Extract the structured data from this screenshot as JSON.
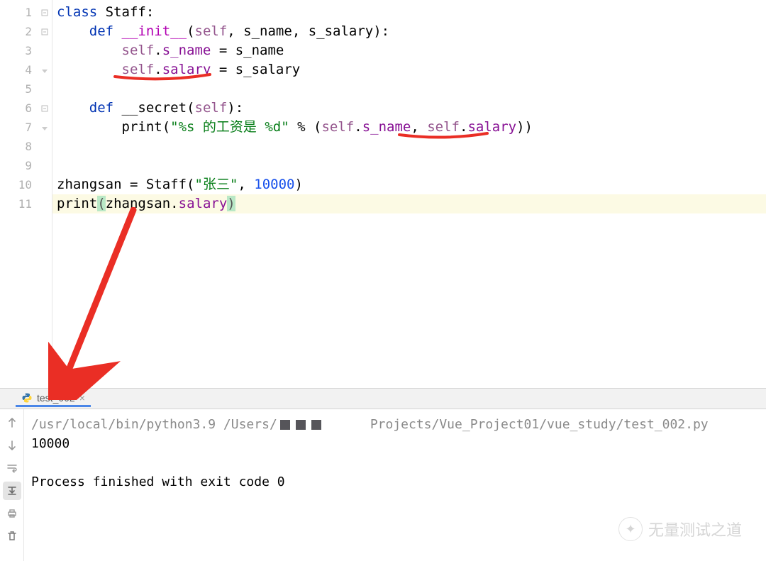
{
  "editor": {
    "line_numbers": [
      "1",
      "2",
      "3",
      "4",
      "5",
      "6",
      "7",
      "8",
      "9",
      "10",
      "11"
    ],
    "lines": {
      "l1": {
        "kw_class": "class",
        "cls": "Staff",
        "colon": ":"
      },
      "l2": {
        "kw_def": "def",
        "fn": "__init__",
        "p1": "(",
        "self": "self",
        "c1": ", ",
        "a1": "s_name",
        "c2": ", ",
        "a2": "s_salary",
        "p2": "):"
      },
      "l3": {
        "self": "self",
        "dot": ".",
        "attr": "s_name",
        "eq": " = ",
        "rhs": "s_name"
      },
      "l4": {
        "self": "self",
        "dot": ".",
        "attr": "salary",
        "eq": " = ",
        "rhs": "s_salary"
      },
      "l6": {
        "kw_def": "def",
        "fn": "__secret",
        "p1": "(",
        "self": "self",
        "p2": "):"
      },
      "l7": {
        "print": "print",
        "p1": "(",
        "str": "\"%s 的工资是 %d\"",
        "pct": " % ",
        "p2": "(",
        "self1": "self",
        "dot1": ".",
        "attr1": "s_name",
        "c": ", ",
        "self2": "self",
        "dot2": ".",
        "attr2": "salary",
        "p3": "))"
      },
      "l10": {
        "lhs": "zhangsan",
        "eq": " = ",
        "cls": "Staff",
        "p1": "(",
        "str": "\"张三\"",
        "c": ", ",
        "num": "10000",
        "p2": ")"
      },
      "l11": {
        "print": "print",
        "p1": "(",
        "obj": "zhangsan",
        "dot": ".",
        "attr": "salary",
        "p2": ")"
      }
    }
  },
  "run": {
    "tab_label": "test_002",
    "cmd_left": "/usr/local/bin/python3.9 /Users/",
    "cmd_right": "Projects/Vue_Project01/vue_study/test_002.py",
    "output_value": "10000",
    "exit_msg": "Process finished with exit code 0"
  },
  "watermark": {
    "text": "无量测试之道"
  },
  "icons": {
    "up": "arrow-up",
    "down": "arrow-down",
    "wrap": "soft-wrap",
    "export": "export",
    "print": "printer",
    "trash": "trash"
  }
}
